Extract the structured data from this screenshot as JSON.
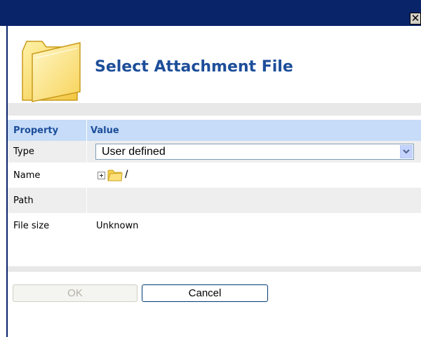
{
  "window": {
    "close_glyph": "✕"
  },
  "dialog": {
    "title": "Select Attachment File",
    "icon": "folder-icon"
  },
  "table": {
    "headers": {
      "property": "Property",
      "value": "Value"
    },
    "rows": {
      "type": {
        "label": "Type",
        "value": "User defined"
      },
      "name": {
        "label": "Name",
        "value": "/"
      },
      "path": {
        "label": "Path",
        "value": ""
      },
      "file_size": {
        "label": "File size",
        "value": "Unknown"
      }
    }
  },
  "buttons": {
    "ok": "OK",
    "cancel": "Cancel"
  },
  "colors": {
    "titlebar": "#0a246a",
    "title_text": "#1d4e9a",
    "header_bg": "#c6dcf8",
    "row_alt_bg": "#eeeeee"
  }
}
